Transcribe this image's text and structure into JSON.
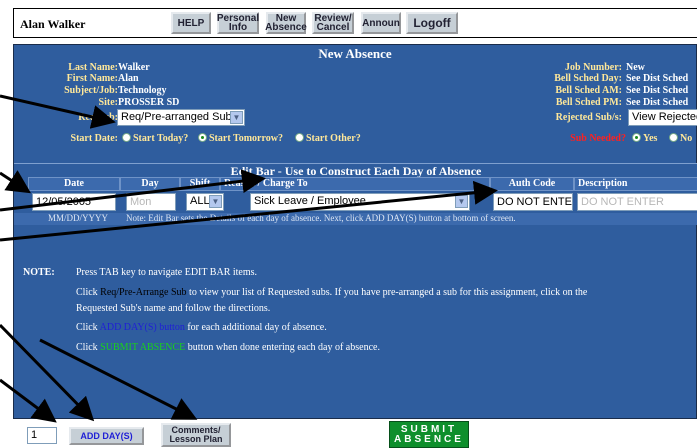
{
  "topbar": {
    "user_name": "Alan Walker",
    "buttons": [
      {
        "label": "HELP"
      },
      {
        "label": "Personal Info"
      },
      {
        "label": "New Absence"
      },
      {
        "label": "Review/ Cancel"
      },
      {
        "label": "Announ"
      },
      {
        "label": "Logoff"
      }
    ]
  },
  "panel": {
    "title": "New Absence",
    "left_fields": [
      {
        "label": "Last Name:",
        "value": "Walker"
      },
      {
        "label": "First Name:",
        "value": "Alan"
      },
      {
        "label": "Subject/Job:",
        "value": "Technology"
      },
      {
        "label": "Site:",
        "value": "PROSSER SD"
      }
    ],
    "right_fields": [
      {
        "label": "Job Number:",
        "value": "New"
      },
      {
        "label": "Bell Sched Day:",
        "value": "See Dist Sched"
      },
      {
        "label": "Bell Sched AM:",
        "value": "See Dist Sched"
      },
      {
        "label": "Bell Sched PM:",
        "value": "See Dist Sched"
      }
    ],
    "req_sub_label": "Req Sub:",
    "req_sub_value": "Req/Pre-arranged Sub",
    "rejected_label": "Rejected Sub/s:",
    "rejected_value": "View Rejected",
    "start_date_label": "Start Date:",
    "start_options": [
      "Start Today?",
      "Start Tomorrow?",
      "Start Other?"
    ],
    "sub_needed_label": "Sub Needed?",
    "sub_needed_options": [
      "Yes",
      "No"
    ]
  },
  "editbar": {
    "title": "Edit Bar - Use to Construct Each Day of Absence",
    "columns": [
      "Date",
      "Day",
      "Shift",
      "Reason / Charge To",
      "Auth Code",
      "Description"
    ],
    "date_value": "12/05/2005",
    "day_value": "Mon",
    "shift_value": "ALL",
    "reason_value": "Sick Leave / Employee",
    "auth_code_value": "DO NOT ENTER",
    "description_placeholder": "DO NOT ENTER",
    "date_format_hint": "MM/DD/YYYY",
    "hint_text": "Note: Edit Bar sets the Details of each day of absence. Next, click ADD DAY(S) button at bottom of screen."
  },
  "notes": {
    "label": "NOTE:",
    "line1": "Press TAB key to navigate EDIT BAR items.",
    "line2_pre": "Click ",
    "line2_hl": "Req/Pre-Arrange Sub",
    "line2_post": " to view your list of Requested subs. If you have pre-arranged a sub for this assignment, click on the",
    "line3": "Requested Sub's name and follow the directions.",
    "line4_pre": "Click ",
    "line4_hl": "ADD DAY(S) button",
    "line4_post": " for each additional day of absence.",
    "line5_pre": "Click ",
    "line5_hl": "SUBMIT ABSENCE",
    "line5_post": " button when done entering each day of absence."
  },
  "bottombar": {
    "day_count": "1",
    "add_days_label": "ADD DAY(S)",
    "comments_label": "Comments/ Lesson Plan",
    "submit_line1": "SUBMIT",
    "submit_line2": "ABSENCE"
  },
  "colors": {
    "panel_bg": "#2f5d9e",
    "label_yellow": "#ffe89a",
    "accent_red": "#ff2020",
    "submit_green": "#0e8f2c"
  }
}
